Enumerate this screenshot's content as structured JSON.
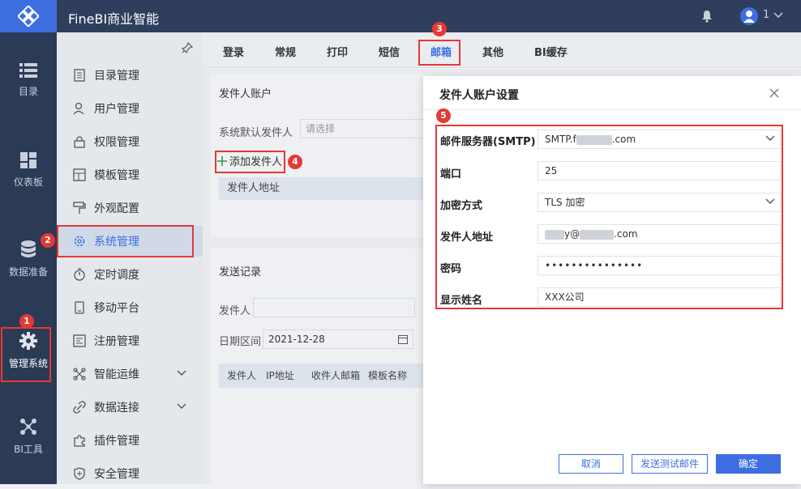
{
  "app": {
    "title": "FineBI商业智能",
    "user_count": "1"
  },
  "rail": {
    "items": [
      {
        "label": "目录",
        "icon": "list-icon"
      },
      {
        "label": "仪表板",
        "icon": "dashboard-icon"
      },
      {
        "label": "数据准备",
        "icon": "database-icon"
      },
      {
        "label": "管理系统",
        "icon": "gear-icon"
      },
      {
        "label": "BI工具",
        "icon": "nodes-icon"
      }
    ]
  },
  "menu": {
    "items": [
      {
        "label": "目录管理"
      },
      {
        "label": "用户管理"
      },
      {
        "label": "权限管理"
      },
      {
        "label": "模板管理"
      },
      {
        "label": "外观配置"
      },
      {
        "label": "系统管理"
      },
      {
        "label": "定时调度"
      },
      {
        "label": "移动平台"
      },
      {
        "label": "注册管理"
      },
      {
        "label": "智能运维"
      },
      {
        "label": "数据连接"
      },
      {
        "label": "插件管理"
      },
      {
        "label": "安全管理"
      }
    ]
  },
  "tabs": [
    "登录",
    "常规",
    "打印",
    "短信",
    "邮箱",
    "其他",
    "BI缓存"
  ],
  "main": {
    "sender_section_title": "发件人账户",
    "default_sender_label": "系统默认发件人",
    "default_sender_placeholder": "请选择",
    "add_sender": "添加发件人",
    "sender_address_header": "发件人地址",
    "send_log_title": "发送记录",
    "sender_filter_label": "发件人",
    "date_range_label": "日期区间",
    "date_value": "2021-12-28",
    "log_headers": [
      "发件人",
      "IP地址",
      "收件人邮箱",
      "模板名称"
    ]
  },
  "modal": {
    "title": "发件人账户设置",
    "fields": {
      "smtp_label": "邮件服务器(SMTP)",
      "smtp_prefix": "SMTP.f",
      "smtp_suffix": ".com",
      "port_label": "端口",
      "port_value": "25",
      "encryption_label": "加密方式",
      "encryption_value": "TLS 加密",
      "sender_label": "发件人地址",
      "sender_mid": "y@",
      "sender_suffix": ".com",
      "password_label": "密码",
      "password_value": "•••••••••••••••",
      "display_name_label": "显示姓名",
      "display_name_value": "XXX公司"
    },
    "buttons": {
      "cancel": "取消",
      "send_test": "发送测试邮件",
      "confirm": "确定"
    }
  },
  "annotations": [
    "1",
    "2",
    "3",
    "4",
    "5"
  ],
  "colors": {
    "accent": "#3d6ee0",
    "annotation": "#e53935",
    "rail": "#2b3a55"
  }
}
